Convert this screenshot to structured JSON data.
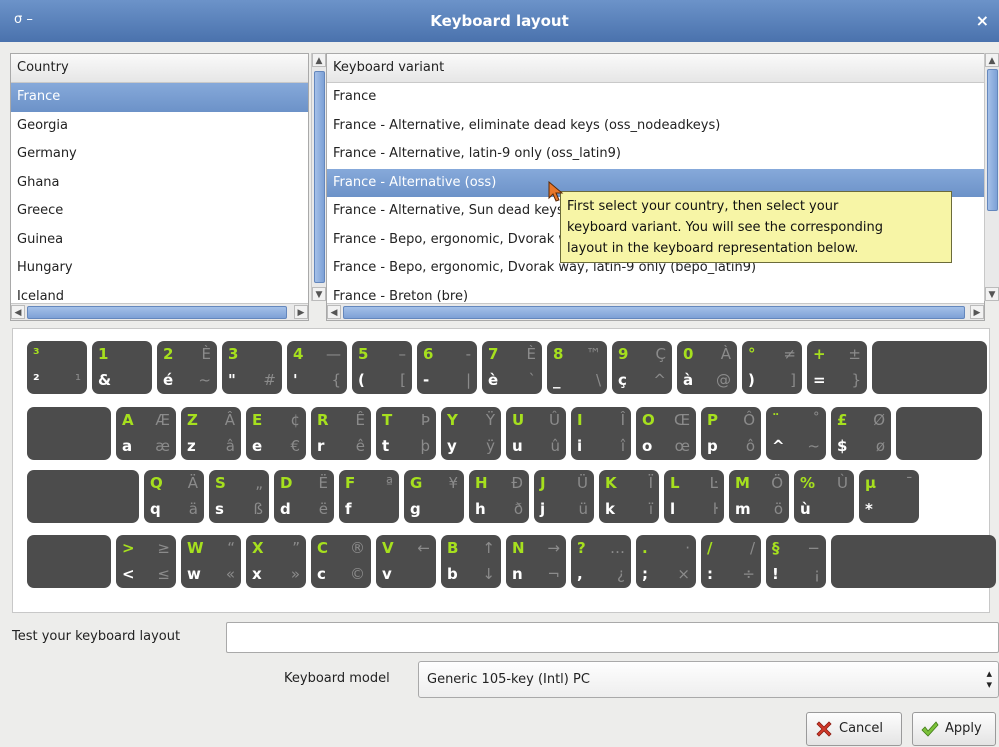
{
  "window": {
    "title": "Keyboard layout",
    "left_controls": "σ –",
    "close_glyph": "×"
  },
  "country_list": {
    "header": "Country",
    "items": [
      "France",
      "Georgia",
      "Germany",
      "Ghana",
      "Greece",
      "Guinea",
      "Hungary",
      "Iceland"
    ],
    "selected": "France"
  },
  "variant_list": {
    "header": "Keyboard variant",
    "items": [
      "France",
      "France - Alternative, eliminate dead keys (oss_nodeadkeys)",
      "France - Alternative, latin-9 only (oss_latin9)",
      "France - Alternative (oss)",
      "France - Alternative, Sun dead keys (oss_sundeadkeys)",
      "France - Bepo, ergonomic, Dvorak way (bepo)",
      "France - Bepo, ergonomic, Dvorak way, latin-9 only (bepo_latin9)",
      "France - Breton (bre)"
    ],
    "selected": "France - Alternative (oss)"
  },
  "tooltip": {
    "lines": [
      "First select your country, then select your",
      "keyboard variant. You will see the corresponding",
      "layout in the keyboard representation below."
    ]
  },
  "keyboard": {
    "rows": [
      [
        [
          "³",
          "",
          "²",
          "¹"
        ],
        [
          "1",
          "",
          "&",
          ""
        ],
        [
          "2",
          "È",
          "é",
          "~"
        ],
        [
          "3",
          "",
          "\"",
          "#"
        ],
        [
          "4",
          "—",
          "'",
          "{"
        ],
        [
          "5",
          "–",
          "(",
          "["
        ],
        [
          "6",
          "‑",
          "-",
          "|"
        ],
        [
          "7",
          "È",
          "è",
          "`"
        ],
        [
          "8",
          "™",
          "_",
          "\\"
        ],
        [
          "9",
          "Ç",
          "ç",
          "^"
        ],
        [
          "0",
          "À",
          "à",
          "@"
        ],
        [
          "°",
          "≠",
          ")",
          "]"
        ],
        [
          "+",
          "±",
          "=",
          "}"
        ],
        [
          "",
          "",
          "",
          ""
        ]
      ],
      [
        [
          "",
          "",
          "",
          ""
        ],
        [
          "A",
          "Æ",
          "a",
          "æ"
        ],
        [
          "Z",
          "Â",
          "z",
          "â"
        ],
        [
          "E",
          "¢",
          "e",
          "€"
        ],
        [
          "R",
          "Ê",
          "r",
          "ê"
        ],
        [
          "T",
          "Þ",
          "t",
          "þ"
        ],
        [
          "Y",
          "Ÿ",
          "y",
          "ÿ"
        ],
        [
          "U",
          "Û",
          "u",
          "û"
        ],
        [
          "I",
          "Î",
          "i",
          "î"
        ],
        [
          "O",
          "Œ",
          "o",
          "œ"
        ],
        [
          "P",
          "Ô",
          "p",
          "ô"
        ],
        [
          "¨",
          "˚",
          "^",
          "~"
        ],
        [
          "£",
          "Ø",
          "$",
          "ø"
        ],
        [
          "",
          "",
          "",
          ""
        ]
      ],
      [
        [
          "",
          "",
          "",
          ""
        ],
        [
          "Q",
          "Ä",
          "q",
          "ä"
        ],
        [
          "S",
          "„",
          "s",
          "ß"
        ],
        [
          "D",
          "Ë",
          "d",
          "ë"
        ],
        [
          "F",
          "ª",
          "f",
          ""
        ],
        [
          "G",
          "¥",
          "g",
          ""
        ],
        [
          "H",
          "Ð",
          "h",
          "ð"
        ],
        [
          "J",
          "Ü",
          "j",
          "ü"
        ],
        [
          "K",
          "Ï",
          "k",
          "ï"
        ],
        [
          "L",
          "Ŀ",
          "l",
          "ŀ"
        ],
        [
          "M",
          "Ö",
          "m",
          "ö"
        ],
        [
          "%",
          "Ù",
          "ù",
          ""
        ],
        [
          "µ",
          "¯",
          "*",
          ""
        ]
      ],
      [
        [
          "",
          "",
          "",
          ""
        ],
        [
          ">",
          "≥",
          "<",
          "≤"
        ],
        [
          "W",
          "“",
          "w",
          "«"
        ],
        [
          "X",
          "”",
          "x",
          "»"
        ],
        [
          "C",
          "®",
          "c",
          "©"
        ],
        [
          "V",
          "←",
          "v",
          ""
        ],
        [
          "B",
          "↑",
          "b",
          "↓"
        ],
        [
          "N",
          "→",
          "n",
          "¬"
        ],
        [
          "?",
          "…",
          ",",
          "¿"
        ],
        [
          ".",
          "·",
          ";",
          "×"
        ],
        [
          "/",
          "/",
          ":",
          "÷"
        ],
        [
          "§",
          "−",
          "!",
          "¡"
        ],
        [
          "",
          "",
          "",
          ""
        ]
      ]
    ]
  },
  "test_field": {
    "label": "Test your keyboard layout",
    "value": ""
  },
  "model": {
    "label": "Keyboard model",
    "value": "Generic 105-key (Intl) PC"
  },
  "buttons": {
    "cancel": "Cancel",
    "apply": "Apply"
  },
  "colors": {
    "accent": "#6c92c8",
    "key_bg": "#4c4c4c",
    "key_green": "#a6e01e",
    "tooltip_bg": "#f7f5a6"
  }
}
